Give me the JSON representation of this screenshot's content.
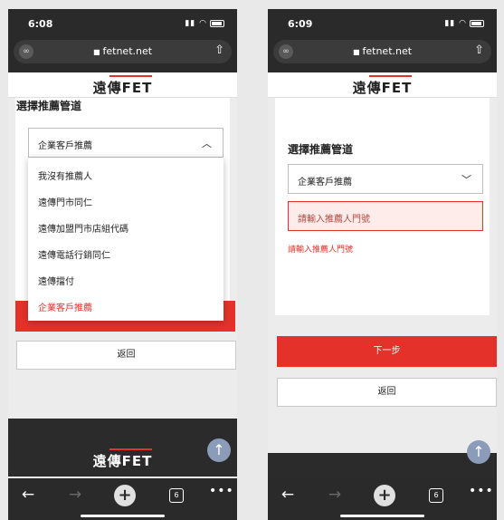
{
  "left": {
    "status_time": "6:08",
    "url": "fetnet.net",
    "brand": "遠傳FET",
    "section_title": "選擇推薦管道",
    "select_value": "企業客戶推薦",
    "dropdown_options": [
      "我沒有推薦人",
      "遠傳門市同仁",
      "遠傳加盟門市店組代碼",
      "遠傳電話行銷同仁",
      "遠傳擋付",
      "企業客戶推薦"
    ],
    "back_label": "返回",
    "footer_brand": "遠傳FET",
    "tabs_count": "6"
  },
  "right": {
    "status_time": "6:09",
    "url": "fetnet.net",
    "brand": "遠傳FET",
    "section_title": "選擇推薦管道",
    "select_value": "企業客戶推薦",
    "input_placeholder": "請輸入推薦人門號",
    "error_text": "請輸入推薦人門號",
    "next_label": "下一步",
    "back_label": "返回",
    "tabs_count": "6"
  },
  "colors": {
    "accent_red": "#e4322b",
    "dark_chrome": "#2a2a2a",
    "error_bg": "#fdecea"
  },
  "icons": {
    "back": "arrow-left-icon",
    "forward": "arrow-right-icon",
    "new_tab": "plus-icon",
    "tabs": "tabs-icon",
    "more": "more-icon",
    "share": "share-icon",
    "lock": "lock-icon",
    "scroll_top": "arrow-up-icon"
  }
}
